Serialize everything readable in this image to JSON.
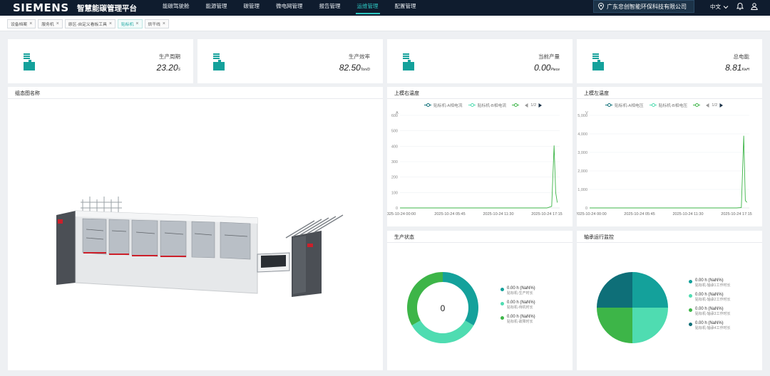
{
  "header": {
    "logo": "SIEMENS",
    "title": "智慧能碳管理平台",
    "nav": [
      "能碳驾驶舱",
      "能源管理",
      "碳管理",
      "微电网管理",
      "报告管理",
      "运维管理",
      "配置管理"
    ],
    "active_nav": "运维管理",
    "company": "广东忠创智能环保科技有限公司",
    "language": "中文"
  },
  "tabs": [
    {
      "label": "设备档案",
      "active": false
    },
    {
      "label": "服务机",
      "active": false
    },
    {
      "label": "原区-自定义看板工具",
      "active": false
    },
    {
      "label": "贴标机",
      "active": true
    },
    {
      "label": "烘干线",
      "active": false
    }
  ],
  "kpis": [
    {
      "label": "生产周期",
      "value": "23.20",
      "unit": "S"
    },
    {
      "label": "生产效率",
      "value": "82.50",
      "unit": "Ton/D"
    },
    {
      "label": "当前产量",
      "value": "0.00",
      "unit": "Piece"
    },
    {
      "label": "总电能",
      "value": "8.81",
      "unit": "KwH"
    }
  ],
  "panels": {
    "diagram_title": "组态图名称",
    "status_title": "生产状态",
    "bearing_title": "轴承运行监控",
    "status_center": "0"
  },
  "colors": {
    "accent": "#2cc5c0",
    "dark_teal": "#0e6f78",
    "teal": "#14a19b",
    "mint": "#4fdcb1",
    "green": "#3db548"
  },
  "chart_data": [
    {
      "type": "line",
      "title": "上模右温度",
      "unit_label": "A",
      "series": [
        {
          "name": "贴标机-A相电流",
          "values": [
            0,
            0,
            0,
            0,
            0,
            0,
            0,
            405,
            30
          ]
        },
        {
          "name": "贴标机-B相电流",
          "values": []
        }
      ],
      "pager": "1/2",
      "x": [
        "2025-10-24 00:00",
        "2025-10-24 05:45",
        "2025-10-24 11:30",
        "2025-10-24 17:15"
      ],
      "x_ticks_shown": [
        "325-10-24 00:00",
        "2025-10-24 05:45",
        "2025-10-24 11:30",
        "2025-10-24 17:15"
      ],
      "yticks": [
        "0",
        "100",
        "200",
        "300",
        "400",
        "500",
        "600"
      ],
      "ylim": [
        0,
        600
      ],
      "points": [
        [
          0.0,
          0
        ],
        [
          0.75,
          0
        ],
        [
          0.92,
          0
        ],
        [
          0.95,
          10
        ],
        [
          0.965,
          405
        ],
        [
          0.975,
          100
        ],
        [
          0.985,
          35
        ]
      ]
    },
    {
      "type": "line",
      "title": "上模左温度",
      "unit_label": "V",
      "series": [
        {
          "name": "贴标机-A相电压",
          "values": []
        },
        {
          "name": "贴标机-B相电压",
          "values": []
        }
      ],
      "pager": "1/2",
      "x": [
        "2025-10-24 00:00",
        "2025-10-24 05:45",
        "2025-10-24 11:30",
        "2025-10-24 17:15"
      ],
      "x_ticks_shown": [
        "2025-10-24 00:00",
        "2025-10-24 05:45",
        "2025-10-24 11:30",
        "2025-10-24 17:15"
      ],
      "yticks": [
        "0",
        "1,000",
        "2,000",
        "3,000",
        "4,000",
        "5,000"
      ],
      "ylim": [
        0,
        5000
      ],
      "points": [
        [
          0.0,
          0
        ],
        [
          0.75,
          0
        ],
        [
          0.92,
          0
        ],
        [
          0.95,
          20
        ],
        [
          0.965,
          3900
        ],
        [
          0.975,
          400
        ],
        [
          0.985,
          300
        ]
      ]
    },
    {
      "type": "pie",
      "title": "生产状态",
      "donut": true,
      "slices": [
        {
          "label": "贴标机-生产时长",
          "value_text": "0.00 h (NaN%)",
          "value": 1,
          "color": "#14a19b"
        },
        {
          "label": "贴标机-待机时长",
          "value_text": "0.00 h (NaN%)",
          "value": 1,
          "color": "#4fdcb1"
        },
        {
          "label": "贴标机-故障时长",
          "value_text": "0.00 h (NaN%)",
          "value": 1,
          "color": "#3db548"
        }
      ]
    },
    {
      "type": "pie",
      "title": "轴承运行监控",
      "donut": false,
      "slices": [
        {
          "label": "贴标机-轴承1工作时长",
          "value_text": "0.00 h (NaN%)",
          "value": 1,
          "color": "#14a19b"
        },
        {
          "label": "贴标机-轴承2工作时长",
          "value_text": "0.00 h (NaN%)",
          "value": 1,
          "color": "#4fdcb1"
        },
        {
          "label": "贴标机-轴承3工作时长",
          "value_text": "0.00 h (NaN%)",
          "value": 1,
          "color": "#3db548"
        },
        {
          "label": "贴标机-轴承4工作时长",
          "value_text": "0.00 h (NaN%)",
          "value": 1,
          "color": "#0e6f78"
        }
      ]
    }
  ]
}
